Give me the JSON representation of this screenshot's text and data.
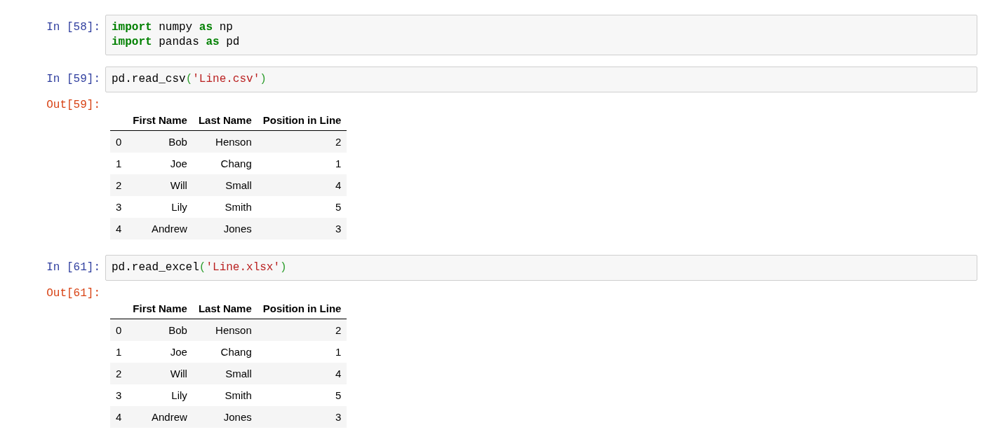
{
  "cells": [
    {
      "prompt": "In [58]:",
      "code": [
        [
          {
            "kind": "keyword",
            "text": "import"
          },
          {
            "kind": "name",
            "text": " numpy "
          },
          {
            "kind": "keyword",
            "text": "as"
          },
          {
            "kind": "name",
            "text": " np"
          }
        ],
        [
          {
            "kind": "keyword",
            "text": "import"
          },
          {
            "kind": "name",
            "text": " pandas "
          },
          {
            "kind": "keyword",
            "text": "as"
          },
          {
            "kind": "name",
            "text": " pd"
          }
        ]
      ]
    },
    {
      "prompt": "In [59]:",
      "code": [
        [
          {
            "kind": "name",
            "text": "pd.read_csv"
          },
          {
            "kind": "paren",
            "text": "("
          },
          {
            "kind": "string",
            "text": "'Line.csv'"
          },
          {
            "kind": "paren",
            "text": ")"
          }
        ]
      ],
      "output": {
        "prompt": "Out[59]:",
        "table": {
          "columns": [
            "First Name",
            "Last Name",
            "Position in Line"
          ],
          "rows": [
            {
              "index": "0",
              "cells": [
                "Bob",
                "Henson",
                "2"
              ]
            },
            {
              "index": "1",
              "cells": [
                "Joe",
                "Chang",
                "1"
              ]
            },
            {
              "index": "2",
              "cells": [
                "Will",
                "Small",
                "4"
              ]
            },
            {
              "index": "3",
              "cells": [
                "Lily",
                "Smith",
                "5"
              ]
            },
            {
              "index": "4",
              "cells": [
                "Andrew",
                "Jones",
                "3"
              ]
            }
          ]
        }
      }
    },
    {
      "prompt": "In [61]:",
      "code": [
        [
          {
            "kind": "name",
            "text": "pd.read_excel"
          },
          {
            "kind": "paren",
            "text": "("
          },
          {
            "kind": "string",
            "text": "'Line.xlsx'"
          },
          {
            "kind": "paren",
            "text": ")"
          }
        ]
      ],
      "output": {
        "prompt": "Out[61]:",
        "table": {
          "columns": [
            "First Name",
            "Last Name",
            "Position in Line"
          ],
          "rows": [
            {
              "index": "0",
              "cells": [
                "Bob",
                "Henson",
                "2"
              ]
            },
            {
              "index": "1",
              "cells": [
                "Joe",
                "Chang",
                "1"
              ]
            },
            {
              "index": "2",
              "cells": [
                "Will",
                "Small",
                "4"
              ]
            },
            {
              "index": "3",
              "cells": [
                "Lily",
                "Smith",
                "5"
              ]
            },
            {
              "index": "4",
              "cells": [
                "Andrew",
                "Jones",
                "3"
              ]
            }
          ]
        }
      }
    }
  ]
}
